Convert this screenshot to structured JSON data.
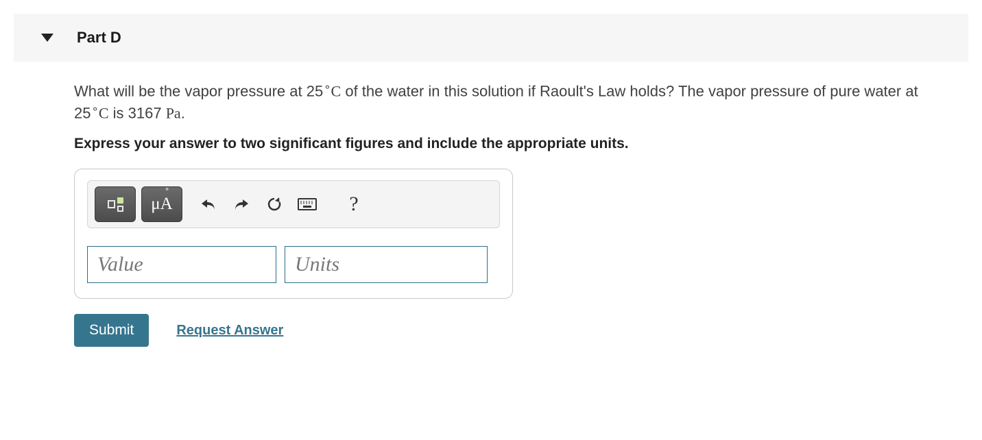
{
  "part": {
    "label": "Part D"
  },
  "question": {
    "pre": "What will be the vapor pressure at 25",
    "deg1": "∘",
    "unit1": "C",
    "mid": " of the water in this solution if Raoult's Law holds? The vapor pressure of pure water at 25",
    "deg2": "∘",
    "unit2": "C",
    "post": " is 3167 ",
    "pa": "Pa",
    "end": "."
  },
  "instruction": "Express your answer to two significant figures and include the appropriate units.",
  "toolbar": {
    "template_label": "template-tool",
    "mu": "μ",
    "A": "A",
    "undo": "↶",
    "redo": "↷",
    "reset": "↻",
    "help": "?"
  },
  "inputs": {
    "value_placeholder": "Value",
    "units_placeholder": "Units"
  },
  "actions": {
    "submit": "Submit",
    "request": "Request Answer"
  }
}
